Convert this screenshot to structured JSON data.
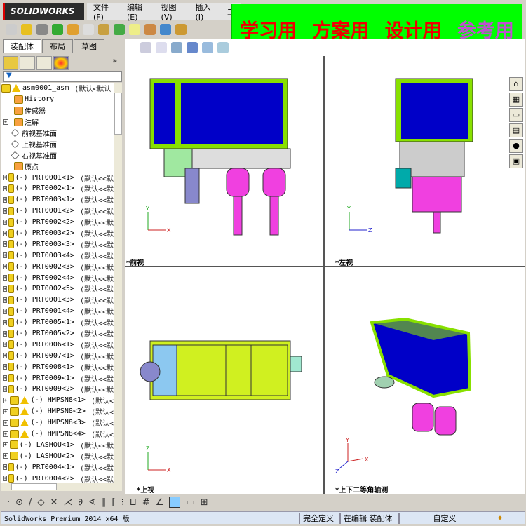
{
  "app": {
    "logo": "SOLIDWORKS"
  },
  "menu": [
    "文件(F)",
    "编辑(E)",
    "视图(V)",
    "插入(I)",
    "工"
  ],
  "banner": [
    "学习用",
    "方案用",
    "设计用",
    "参考用"
  ],
  "tabs": [
    "装配体",
    "布局",
    "草图"
  ],
  "filter": "▼",
  "tree": {
    "root": {
      "name": "asm0001_asm",
      "config": "(默认<默认"
    },
    "fixed": [
      {
        "name": "History",
        "icon": "history-icon"
      },
      {
        "name": "传感器",
        "icon": "sensor-icon"
      },
      {
        "name": "注解",
        "icon": "annotation-icon",
        "expand": true
      },
      {
        "name": "前视基准面",
        "icon": "plane-icon"
      },
      {
        "name": "上视基准面",
        "icon": "plane-icon"
      },
      {
        "name": "右视基准面",
        "icon": "plane-icon"
      },
      {
        "name": "原点",
        "icon": "origin-icon"
      }
    ],
    "parts": [
      {
        "name": "(-) PRT0001<1>",
        "config": "(默认<<默"
      },
      {
        "name": "(-) PRT0002<1>",
        "config": "(默认<<默"
      },
      {
        "name": "(-) PRT0003<1>",
        "config": "(默认<<默"
      },
      {
        "name": "(-) PRT0001<2>",
        "config": "(默认<<默"
      },
      {
        "name": "(-) PRT0002<2>",
        "config": "(默认<<默"
      },
      {
        "name": "(-) PRT0003<2>",
        "config": "(默认<<默"
      },
      {
        "name": "(-) PRT0003<3>",
        "config": "(默认<<默"
      },
      {
        "name": "(-) PRT0003<4>",
        "config": "(默认<<默"
      },
      {
        "name": "(-) PRT0002<3>",
        "config": "(默认<<默"
      },
      {
        "name": "(-) PRT0002<4>",
        "config": "(默认<<默"
      },
      {
        "name": "(-) PRT0002<5>",
        "config": "(默认<<默"
      },
      {
        "name": "(-) PRT0001<3>",
        "config": "(默认<<默"
      },
      {
        "name": "(-) PRT0001<4>",
        "config": "(默认<<默"
      },
      {
        "name": "(-) PRT0005<1>",
        "config": "(默认<<默"
      },
      {
        "name": "(-) PRT0005<2>",
        "config": "(默认<<默"
      },
      {
        "name": "(-) PRT0006<1>",
        "config": "(默认<<默"
      },
      {
        "name": "(-) PRT0007<1>",
        "config": "(默认<<默"
      },
      {
        "name": "(-) PRT0008<1>",
        "config": "(默认<<默"
      },
      {
        "name": "(-) PRT0009<1>",
        "config": "(默认<<默"
      },
      {
        "name": "(-) PRT0009<2>",
        "config": "(默认<<默"
      },
      {
        "name": "(-) HMPSN8<1>",
        "config": "(默认<",
        "warn": true
      },
      {
        "name": "(-) HMPSN8<2>",
        "config": "(默认<",
        "warn": true
      },
      {
        "name": "(-) HMPSN8<3>",
        "config": "(默认<",
        "warn": true
      },
      {
        "name": "(-) HMPSN8<4>",
        "config": "(默认<",
        "warn": true
      },
      {
        "name": "(-) LASHOU<1>",
        "config": "(默认<<默"
      },
      {
        "name": "(-) LASHOU<2>",
        "config": "(默认<<默"
      },
      {
        "name": "(-) PRT0004<1>",
        "config": "(默认<<默"
      },
      {
        "name": "(-) PRT0004<2>",
        "config": "(默认<<默"
      }
    ]
  },
  "views": {
    "front": "*前视",
    "left": "*左视",
    "top": "*上视",
    "iso": "*上下二等角轴测"
  },
  "status": {
    "product": "SolidWorks Premium 2014 x64 版",
    "defined": "完全定义",
    "editing": "在编辑 装配体",
    "units": "自定义"
  },
  "colors": {
    "frame": "#88e000",
    "panel": "#0000c8",
    "pink": "#f040e0",
    "banner": "#00ff00"
  }
}
